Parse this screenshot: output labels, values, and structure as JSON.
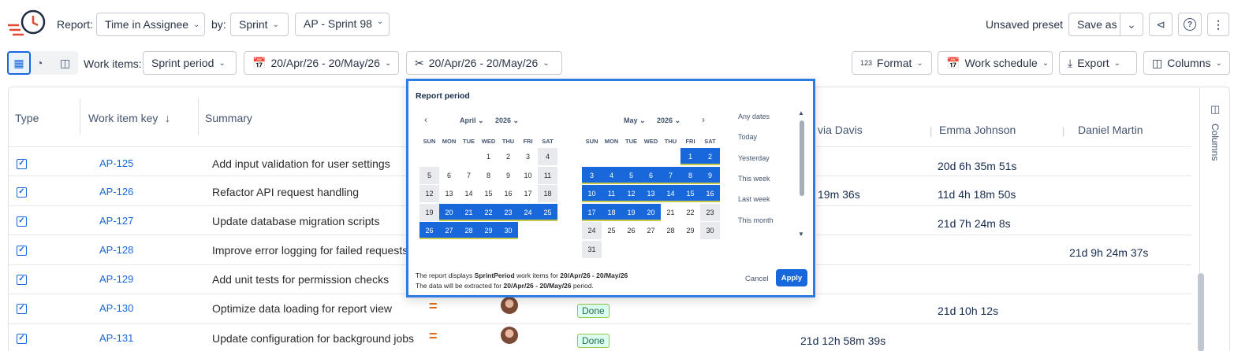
{
  "toolbar": {
    "report_label": "Report:",
    "report_value": "Time in Assignee",
    "by_label": "by:",
    "by_value": "Sprint",
    "sprint_value": "AP - Sprint 98",
    "preset_status": "Unsaved preset",
    "save_as": "Save as"
  },
  "filters": {
    "work_items_label": "Work items:",
    "work_items_value": "Sprint period",
    "date_range": "20/Apr/26 - 20/May/26",
    "cut_range": "20/Apr/26 - 20/May/26",
    "format": "Format",
    "format_icon_text": "123",
    "work_schedule": "Work schedule",
    "export": "Export",
    "columns": "Columns"
  },
  "table": {
    "headers": {
      "type": "Type",
      "key": "Work item key",
      "summary": "Summary",
      "col4": "via Davis",
      "col5": "Emma Johnson",
      "col6": "Daniel Martin"
    },
    "rows": [
      {
        "key": "AP-125",
        "summary": "Add input validation for user settings",
        "c5": "20d 6h 35m 51s"
      },
      {
        "key": "AP-126",
        "summary": "Refactor API request handling",
        "c4": "19m 36s",
        "c5": "11d 4h 18m 50s"
      },
      {
        "key": "AP-127",
        "summary": "Update database migration scripts",
        "c5": "21d 7h 24m 8s"
      },
      {
        "key": "AP-128",
        "summary": "Improve error logging for failed requests",
        "c6": "21d 9h 24m 37s"
      },
      {
        "key": "AP-129",
        "summary": "Add unit tests for permission checks"
      },
      {
        "key": "AP-130",
        "summary": "Optimize data loading for report view",
        "status": "Done",
        "c5": "21d 10h 12s"
      },
      {
        "key": "AP-131",
        "summary": "Update configuration for background jobs",
        "status": "Done",
        "c4": "21d 12h 58m 39s"
      }
    ],
    "side_panel_label": "Columns"
  },
  "popup": {
    "title": "Report period",
    "left_month": "April",
    "left_year": "2026",
    "right_month": "May",
    "right_year": "2026",
    "weekdays": [
      "SUN",
      "MON",
      "TUE",
      "WED",
      "THU",
      "FRI",
      "SAT"
    ],
    "quick": [
      "Any dates",
      "Today",
      "Yesterday",
      "This week",
      "Last week",
      "This month"
    ],
    "footer_line1_prefix": "The report displays ",
    "footer_line1_bold": "SprintPeriod",
    "footer_line1_mid": " work items for ",
    "footer_line1_range": "20/Apr/26 - 20/May/26",
    "footer_line2_prefix": "The data will be extracted for ",
    "footer_line2_range": "20/Apr/26 - 20/May/26",
    "footer_line2_suffix": " period.",
    "cancel": "Cancel",
    "apply": "Apply"
  }
}
